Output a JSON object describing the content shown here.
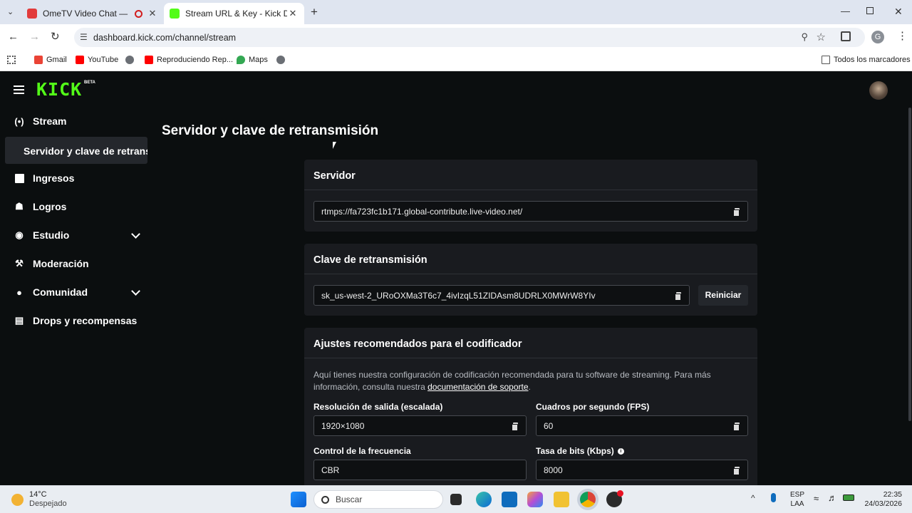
{
  "browser": {
    "tabs": [
      {
        "title": "OmeTV Video Chat — Omegle",
        "active": false
      },
      {
        "title": "Stream URL & Key - Kick Dashboard",
        "active": true
      }
    ],
    "new_tab_icon": "+",
    "url": "dashboard.kick.com/channel/stream",
    "bookmarks": [
      {
        "label": "Gmail"
      },
      {
        "label": "YouTube"
      },
      {
        "label": ""
      },
      {
        "label": "Reproduciendo Rep..."
      },
      {
        "label": "Maps"
      },
      {
        "label": ""
      }
    ],
    "bookmarks_folder": "Todos los marcadores",
    "profile_initial": "G"
  },
  "app": {
    "logo": "KICK",
    "logo_badge": "BETA",
    "sidebar": {
      "items": [
        {
          "label": "Stream",
          "icon": "broadcast-icon"
        },
        {
          "label": "Servidor y clave de retransmisión",
          "active": true
        },
        {
          "label": "Ingresos",
          "icon": "bar-chart-icon"
        },
        {
          "label": "Logros",
          "icon": "trophy-icon"
        },
        {
          "label": "Estudio",
          "icon": "palette-icon",
          "expandable": true
        },
        {
          "label": "Moderación",
          "icon": "wrench-icon"
        },
        {
          "label": "Comunidad",
          "icon": "group-icon",
          "expandable": true
        },
        {
          "label": "Drops y recompensas",
          "icon": "gift-icon"
        }
      ]
    },
    "page_title": "Servidor y clave de retransmisión",
    "server": {
      "heading": "Servidor",
      "value": "rtmps://fa723fc1b171.global-contribute.live-video.net/"
    },
    "stream_key": {
      "heading": "Clave de retransmisión",
      "value": "sk_us-west-2_URoOXMa3T6c7_4ivIzqL51ZIDAsm8UDRLX0MWrW8YIv",
      "reset_label": "Reiniciar"
    },
    "encoder": {
      "heading": "Ajustes recomendados para el codificador",
      "description": "Aquí tienes nuestra configuración de codificación recomendada para tu software de streaming. Para más información, consulta nuestra ",
      "link_text": "documentación de soporte",
      "after_link": ".",
      "fields": {
        "resolution": {
          "label": "Resolución de salida (escalada)",
          "value": "1920×1080"
        },
        "fps": {
          "label": "Cuadros por segundo (FPS)",
          "value": "60"
        },
        "rate_control": {
          "label": "Control de la frecuencia",
          "value": "CBR"
        },
        "bitrate": {
          "label": "Tasa de bits (Kbps)",
          "value": "8000"
        }
      }
    }
  },
  "taskbar": {
    "weather_temp": "14°C",
    "weather_desc": "Despejado",
    "search_placeholder": "Buscar",
    "lang_line1": "ESP",
    "lang_line2": "LAA",
    "time": "22:35",
    "date": "24/03/2026"
  },
  "colors": {
    "kick_green": "#53fc18",
    "panel": "#191b1f",
    "background": "#0b0e0f"
  }
}
